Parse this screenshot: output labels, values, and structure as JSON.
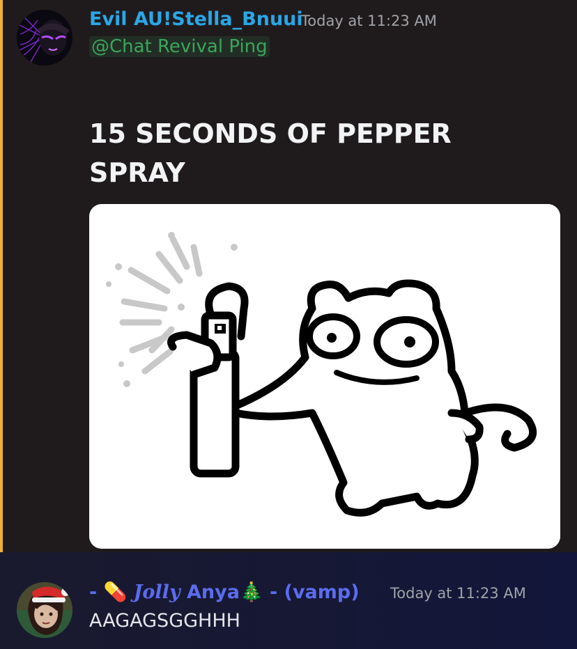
{
  "messages": [
    {
      "username": "Evil AU!Stella_Bnuui",
      "timestamp": "Today at 11:23 AM",
      "mention": "@Chat Revival Ping",
      "headline": "15 SECONDS OF PEPPER SPRAY",
      "username_color": "#2aa7e6",
      "mention_color": "#3ba55c",
      "highlight_bar_color": "#f0b132"
    },
    {
      "username_prefix": "- ",
      "username_emoji1": "💊",
      "username_fancy": "Jolly",
      "username_name": " Anya",
      "username_emoji2": "🎄",
      "username_suffix": " - (vamp)",
      "timestamp": "Today at 11:23 AM",
      "text": "AAGAGSGGHHH",
      "username_color": "#5b6cf0"
    }
  ],
  "icons": [
    "avatar-image",
    "pepper-spray-cat-image"
  ]
}
